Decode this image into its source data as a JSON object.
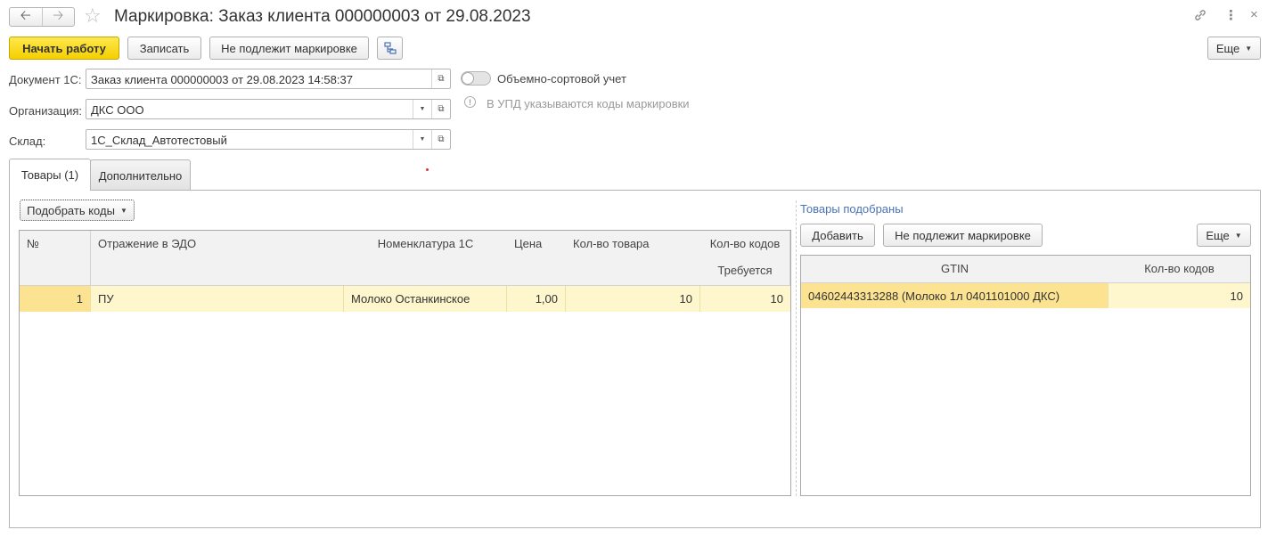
{
  "window": {
    "title": "Маркировка: Заказ клиента 000000003 от 29.08.2023"
  },
  "header_icons": [
    "link-icon",
    "more-vertical-icon",
    "close-icon"
  ],
  "toolbar": {
    "start_label": "Начать работу",
    "save_label": "Записать",
    "not_subject_label": "Не подлежит маркировке",
    "more_label": "Еще"
  },
  "form": {
    "document_label": "Документ 1С:",
    "document_value": "Заказ клиента 000000003 от 29.08.2023 14:58:37",
    "organization_label": "Организация:",
    "organization_value": "ДКС ООО",
    "warehouse_label": "Склад:",
    "warehouse_value": "1С_Склад_Автотестовый",
    "bulk_toggle_label": "Объемно-сортовой учет",
    "upd_info": "В УПД указываются коды маркировки"
  },
  "tabs": [
    {
      "label": "Товары (1)",
      "active": true
    },
    {
      "label": "Дополнительно",
      "active": false
    }
  ],
  "goods": {
    "pick_codes_label": "Подобрать коды",
    "columns": {
      "num": "№",
      "edo": "Отражение в ЭДО",
      "nomenclature": "Номенклатура 1С",
      "price": "Цена",
      "qty": "Кол-во товара",
      "codes": "Кол-во кодов",
      "required": "Требуется"
    },
    "rows": [
      {
        "num": "1",
        "edo": "ПУ",
        "nomenclature": "Молоко Останкинское",
        "price": "1,00",
        "qty": "10",
        "required": "10"
      }
    ]
  },
  "picked": {
    "title": "Товары подобраны",
    "add_label": "Добавить",
    "not_subject_label": "Не подлежит маркировке",
    "more_label": "Еще",
    "columns": {
      "gtin": "GTIN",
      "codes": "Кол-во кодов"
    },
    "rows": [
      {
        "gtin": "04602443313288 (Молоко 1л 0401101000 ДКС)",
        "codes": "10"
      }
    ]
  },
  "colors": {
    "primary_button": "#f5cf00",
    "selected_row": "#fef6cc",
    "section_title": "#4a72b8"
  }
}
